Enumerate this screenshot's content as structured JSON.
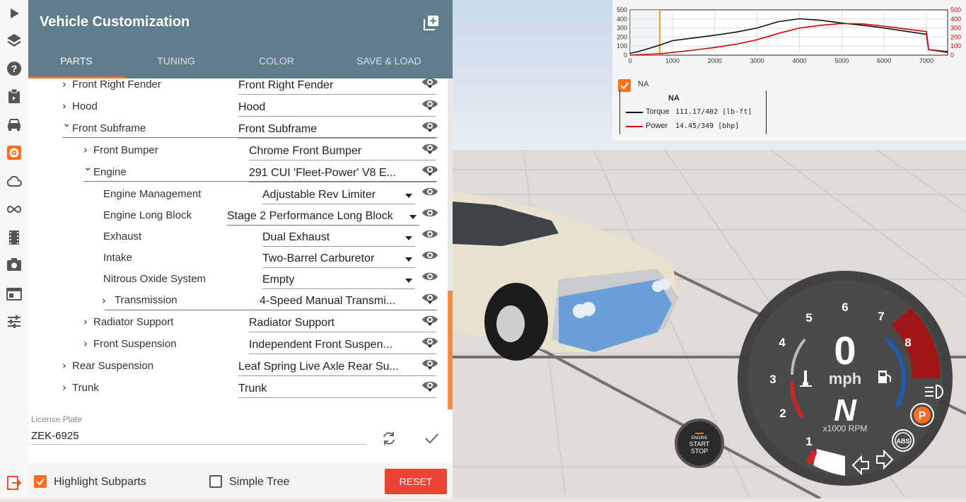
{
  "panel": {
    "title": "Vehicle Customization",
    "tabs": [
      {
        "label": "PARTS"
      },
      {
        "label": "TUNING"
      },
      {
        "label": "COLOR"
      },
      {
        "label": "SAVE & LOAD"
      }
    ],
    "active_tab": "PARTS"
  },
  "tree": [
    {
      "label": "Front Right Fender",
      "value": "Front Right Fender",
      "expanded": false
    },
    {
      "label": "Hood",
      "value": "Hood",
      "expanded": false
    },
    {
      "label": "Front Subframe",
      "value": "Front Subframe",
      "expanded": true
    },
    {
      "label": "Front Bumper",
      "value": "Chrome Front Bumper",
      "expanded": false
    },
    {
      "label": "Engine",
      "value": "291 CUI 'Fleet-Power' V8 E...",
      "expanded": true
    },
    {
      "label": "Engine Management",
      "value": "Adjustable Rev Limiter"
    },
    {
      "label": "Engine Long Block",
      "value": "Stage 2 Performance Long Block"
    },
    {
      "label": "Exhaust",
      "value": "Dual Exhaust"
    },
    {
      "label": "Intake",
      "value": "Two-Barrel Carburetor"
    },
    {
      "label": "Nitrous Oxide System",
      "value": "Empty"
    },
    {
      "label": "Transmission",
      "value": "4-Speed Manual Transmi...",
      "expanded": false
    },
    {
      "label": "Radiator Support",
      "value": "Radiator Support",
      "expanded": false
    },
    {
      "label": "Front Suspension",
      "value": "Independent Front Suspen...",
      "expanded": false
    },
    {
      "label": "Rear Suspension",
      "value": "Leaf Spring Live Axle Rear Su...",
      "expanded": false
    },
    {
      "label": "Trunk",
      "value": "Trunk",
      "expanded": false
    }
  ],
  "license": {
    "label": "License Plate",
    "value": "ZEK-6925"
  },
  "footer": {
    "highlight_label": "Highlight Subparts",
    "highlight_checked": true,
    "simple_tree_label": "Simple Tree",
    "simple_tree_checked": false,
    "reset_label": "RESET"
  },
  "graph": {
    "checkbox_label": "NA",
    "legend_title": "NA",
    "torque_label": "Torque",
    "torque_value": "111.17/402 [lb-ft]",
    "power_label": "Power",
    "power_value": "14.45/349  [bhp]",
    "x_ticks": [
      "0",
      "1000",
      "2000",
      "3000",
      "4000",
      "5000",
      "6000",
      "7000"
    ],
    "y_ticks_left": [
      "0",
      "100",
      "200",
      "300",
      "400",
      "500"
    ],
    "y_ticks_right": [
      "0",
      "100",
      "200",
      "300",
      "400",
      "500"
    ],
    "current_rpm": 700,
    "torque_curve": [
      [
        0,
        20
      ],
      [
        200,
        40
      ],
      [
        700,
        110
      ],
      [
        1000,
        160
      ],
      [
        1500,
        190
      ],
      [
        2000,
        220
      ],
      [
        2500,
        255
      ],
      [
        3000,
        300
      ],
      [
        3500,
        370
      ],
      [
        4000,
        402
      ],
      [
        4500,
        385
      ],
      [
        5000,
        355
      ],
      [
        5500,
        330
      ],
      [
        6000,
        300
      ],
      [
        6500,
        265
      ],
      [
        7000,
        230
      ],
      [
        7050,
        60
      ],
      [
        7500,
        40
      ]
    ],
    "power_curve": [
      [
        0,
        0
      ],
      [
        700,
        15
      ],
      [
        1000,
        30
      ],
      [
        1500,
        55
      ],
      [
        2000,
        85
      ],
      [
        2500,
        120
      ],
      [
        3000,
        170
      ],
      [
        3500,
        240
      ],
      [
        4000,
        300
      ],
      [
        4500,
        330
      ],
      [
        5000,
        349
      ],
      [
        5500,
        345
      ],
      [
        6000,
        320
      ],
      [
        6500,
        290
      ],
      [
        7000,
        260
      ],
      [
        7050,
        60
      ],
      [
        7500,
        30
      ]
    ],
    "colors": {
      "torque": "#111111",
      "power": "#d40000",
      "rpm_marker": "#f0a000"
    }
  },
  "dash": {
    "speed": "0",
    "speed_unit": "mph",
    "gear": "N",
    "rpm_unit": "x1000 RPM",
    "rpm_numbers": [
      "1",
      "2",
      "3",
      "4",
      "5",
      "6",
      "7",
      "8"
    ],
    "abs_label": "ABS",
    "parking_label": "P"
  },
  "engine_button": {
    "line1": "ENGINE",
    "line2": "START",
    "line3": "STOP"
  },
  "rail_icons": [
    "play-icon",
    "layers-icon",
    "help-icon",
    "clipboard-icon",
    "car-icon",
    "gear-icon",
    "cloud-icon",
    "infinity-icon",
    "film-icon",
    "camera-icon",
    "window-icon",
    "sliders-icon",
    "exit-icon"
  ]
}
